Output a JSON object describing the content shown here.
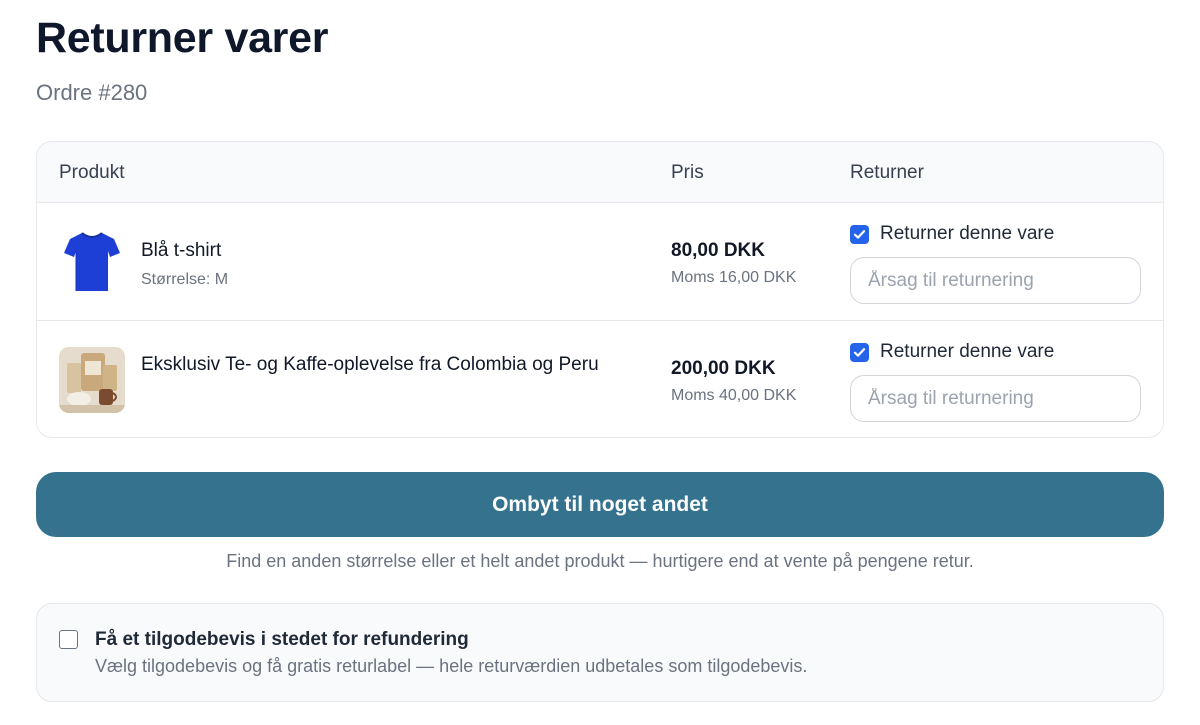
{
  "header": {
    "title": "Returner varer",
    "order_label": "Ordre #280"
  },
  "table": {
    "columns": {
      "product": "Produkt",
      "price": "Pris",
      "return": "Returner"
    },
    "rows": [
      {
        "name": "Blå t-shirt",
        "variant": "Størrelse: M",
        "price": "80,00 DKK",
        "vat": "Moms 16,00 DKK",
        "return_checked": true,
        "return_label": "Returner denne vare",
        "reason_placeholder": "Årsag til returnering",
        "reason_value": "",
        "image": "blue-tshirt-image"
      },
      {
        "name": "Eksklusiv Te- og Kaffe-oplevelse fra Colombia og Peru",
        "variant": "",
        "price": "200,00 DKK",
        "vat": "Moms 40,00 DKK",
        "return_checked": true,
        "return_label": "Returner denne vare",
        "reason_placeholder": "Årsag til returnering",
        "reason_value": "",
        "image": "tea-coffee-set-image"
      }
    ]
  },
  "exchange": {
    "button_label": "Ombyt til noget andet",
    "note": "Find en anden størrelse eller et helt andet produkt — hurtigere end at vente på pengene retur."
  },
  "store_credit": {
    "checked": false,
    "title": "Få et tilgodebevis i stedet for refundering",
    "description": "Vælg tilgodebevis og få gratis returlabel — hele returværdien udbetales som tilgodebevis."
  },
  "colors": {
    "accent": "#35728d",
    "checkbox": "#2563eb"
  }
}
